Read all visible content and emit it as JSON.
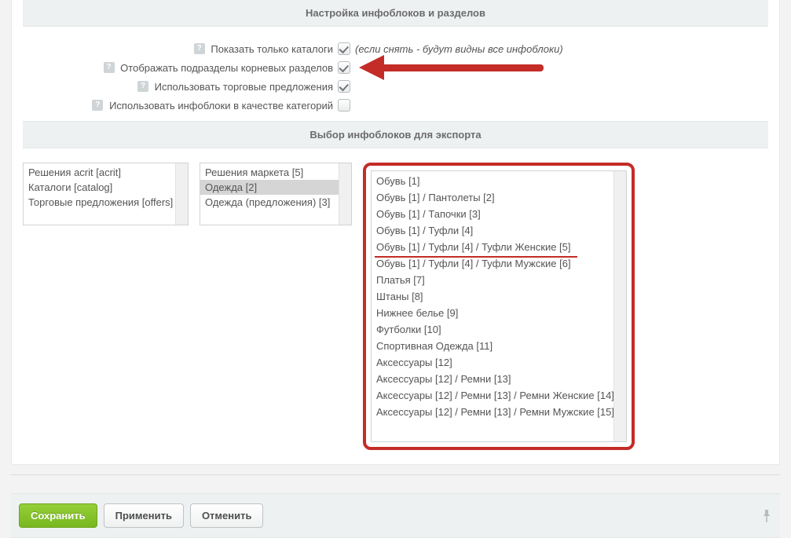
{
  "sections": {
    "settings_title": "Настройка инфоблоков и разделов",
    "export_title": "Выбор инфоблоков для экспорта"
  },
  "settings": {
    "show_catalogs_only": {
      "label": "Показать только каталоги",
      "hint": "(если снять - будут видны все инфоблоки)"
    },
    "show_subsections": {
      "label": "Отображать подразделы корневых разделов"
    },
    "use_trade_offers": {
      "label": "Использовать торговые предложения"
    },
    "iblocks_as_categories": {
      "label": "Использовать инфоблоки в качестве категорий"
    }
  },
  "listbox1": {
    "items": [
      "Решения acrit [acrit]",
      "Каталоги [catalog]",
      "Торговые предложения [offers]"
    ]
  },
  "listbox2": {
    "items": [
      "Решения маркета [5]",
      "Одежда [2]",
      "Одежда (предложения) [3]"
    ],
    "selected_index": 1
  },
  "listbox3": {
    "items": [
      "Обувь [1]",
      "Обувь [1] / Пантолеты [2]",
      "Обувь [1] / Тапочки [3]",
      "Обувь [1] / Туфли [4]",
      "Обувь [1] / Туфли [4] / Туфли Женские [5]",
      "Обувь [1] / Туфли [4] / Туфли Мужские [6]",
      "Платья [7]",
      "Штаны [8]",
      "Нижнее белье [9]",
      "Футболки [10]",
      "Спортивная Одежда [11]",
      "Аксессуары [12]",
      "Аксессуары [12] / Ремни [13]",
      "Аксессуары [12] / Ремни [13] / Ремни Женские [14]",
      "Аксессуары [12] / Ремни [13] / Ремни Мужские [15]"
    ],
    "underline_index": 4
  },
  "footer": {
    "save": "Сохранить",
    "apply": "Применить",
    "cancel": "Отменить"
  }
}
